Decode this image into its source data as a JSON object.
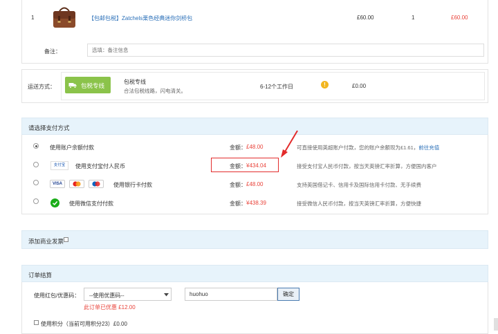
{
  "order_item": {
    "index": "1",
    "product_name": "【包邮包税】Zatchels栗色经典迷你剑桥包",
    "unit_price": "£60.00",
    "quantity": "1",
    "subtotal": "£60.00"
  },
  "remark": {
    "label": "备注：",
    "placeholder": "选填：备注信息"
  },
  "shipping": {
    "label": "运送方式：",
    "badge": "包税专线",
    "name": "包税专线",
    "desc": "合法包税线路，闪电清关。",
    "duration": "6-12个工作日",
    "price": "£0.00"
  },
  "payment": {
    "title": "请选择支付方式",
    "amount_label": "金额：",
    "methods": [
      {
        "label": "使用账户余额付款",
        "amount": "£48.00",
        "note_prefix": "可直接使用英超账户付款，您的账户余额现为£1.61，",
        "note_link": "前往充值"
      },
      {
        "label": "使用支付宝付人民币",
        "amount": "¥434.04",
        "note": "接受支付宝人民币付款，按当天英镑汇率折算，方便国内客户"
      },
      {
        "label": "使用银行卡付款",
        "amount": "£48.00",
        "note": "支持英国借记卡、信用卡及国际信用卡付款、无手续费"
      },
      {
        "label": "使用微信支付付款",
        "amount": "¥438.39",
        "note": "接受微信人民币付款，按当天英镑汇率折算，方便快捷"
      }
    ],
    "cards": [
      "VISA",
      "MC",
      "MAESTRO"
    ],
    "alipay_logo": "支付宝"
  },
  "invoice": {
    "label": "添加商业发票"
  },
  "checkout": {
    "title": "订单结算",
    "coupon_label": "使用红包/优惠码：",
    "coupon_select": "--使用优惠码--",
    "coupon_code": "huohuo",
    "confirm_button": "确定",
    "discount_note": "此订单已优惠 £12.00",
    "points_label": "使用积分（当前可用积分23）£0.00"
  },
  "colors": {
    "accent_red": "#e9433a",
    "link_blue": "#2a6fb8",
    "section_header_bg": "#e7f3fb",
    "shipping_badge_green": "#8bc34a",
    "annotation_red": "#e32b2b"
  }
}
